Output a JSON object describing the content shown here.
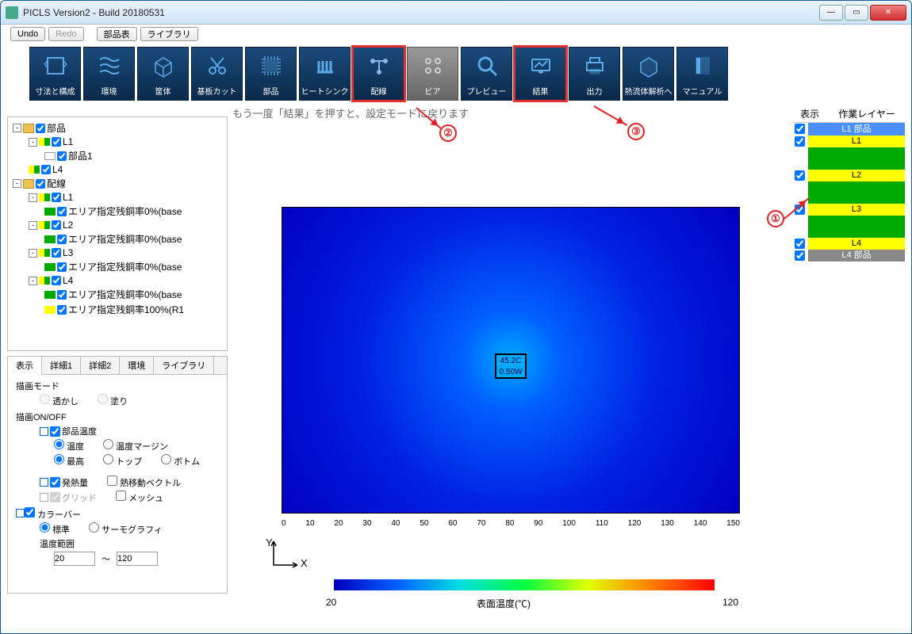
{
  "window": {
    "title": "PICLS Version2 - Build 20180531"
  },
  "top_buttons": {
    "undo": "Undo",
    "redo": "Redo",
    "parts_table": "部品表",
    "library": "ライブラリ"
  },
  "toolbar": [
    {
      "label": "寸法と構成"
    },
    {
      "label": "環境"
    },
    {
      "label": "筐体"
    },
    {
      "label": "基板カット"
    },
    {
      "label": "部品"
    },
    {
      "label": "ヒートシンク"
    },
    {
      "label": "配線"
    },
    {
      "label": "ビア"
    },
    {
      "label": "プレビュー"
    },
    {
      "label": "結果"
    },
    {
      "label": "出力"
    },
    {
      "label": "熱流体解析へ"
    },
    {
      "label": "マニュアル"
    }
  ],
  "help_text": "もう一度「結果」を押すと、設定モードに戻ります",
  "tree": {
    "parts": "部品",
    "l1": "L1",
    "parts1": "部品1",
    "l4": "L4",
    "wiring": "配線",
    "w_l1": "L1",
    "w_l1_item": "エリア指定残銅率0%(base",
    "w_l2": "L2",
    "w_l2_item": "エリア指定残銅率0%(base",
    "w_l3": "L3",
    "w_l3_item": "エリア指定残銅率0%(base",
    "w_l4": "L4",
    "w_l4_item1": "エリア指定残銅率0%(base",
    "w_l4_item2": "エリア指定残銅率100%(R1"
  },
  "prop_tabs": {
    "display": "表示",
    "detail1": "詳細1",
    "detail2": "詳細2",
    "env": "環境",
    "library": "ライブラリ"
  },
  "props": {
    "draw_mode": "描画モード",
    "transparent": "透かし",
    "fill": "塗り",
    "draw_onoff": "描画ON/OFF",
    "parts_temp": "部品温度",
    "temp": "温度",
    "temp_margin": "温度マージン",
    "max": "最高",
    "top": "トップ",
    "bottom": "ボトム",
    "heat": "発熱量",
    "heat_vector": "熱移動ベクトル",
    "grid": "グリッド",
    "mesh": "メッシュ",
    "colorbar": "カラーバー",
    "standard": "標準",
    "thermography": "サーモグラフィ",
    "temp_range": "温度範囲",
    "range_low": "20",
    "tilde": "～",
    "range_high": "120"
  },
  "right": {
    "display": "表示",
    "work_layer": "作業レイヤー",
    "layers": [
      "L1 部品",
      "L1",
      "L2",
      "L3",
      "L4",
      "L4 部品"
    ]
  },
  "chart_data": {
    "type": "heatmap",
    "title": "",
    "xlabel": "X",
    "ylabel": "Y",
    "x_range": [
      0,
      150
    ],
    "x_ticks": [
      "0",
      "10",
      "20",
      "30",
      "40",
      "50",
      "60",
      "70",
      "80",
      "90",
      "100",
      "110",
      "120",
      "130",
      "140",
      "150"
    ],
    "hotspot": {
      "temp_text": "45.2C",
      "power_text": "0.50W",
      "x": 70,
      "y": 50
    },
    "colorbar": {
      "label": "表面温度(℃)",
      "min": "20",
      "max": "120"
    }
  },
  "annotations": {
    "n1": "①",
    "n2": "②",
    "n3": "③"
  }
}
